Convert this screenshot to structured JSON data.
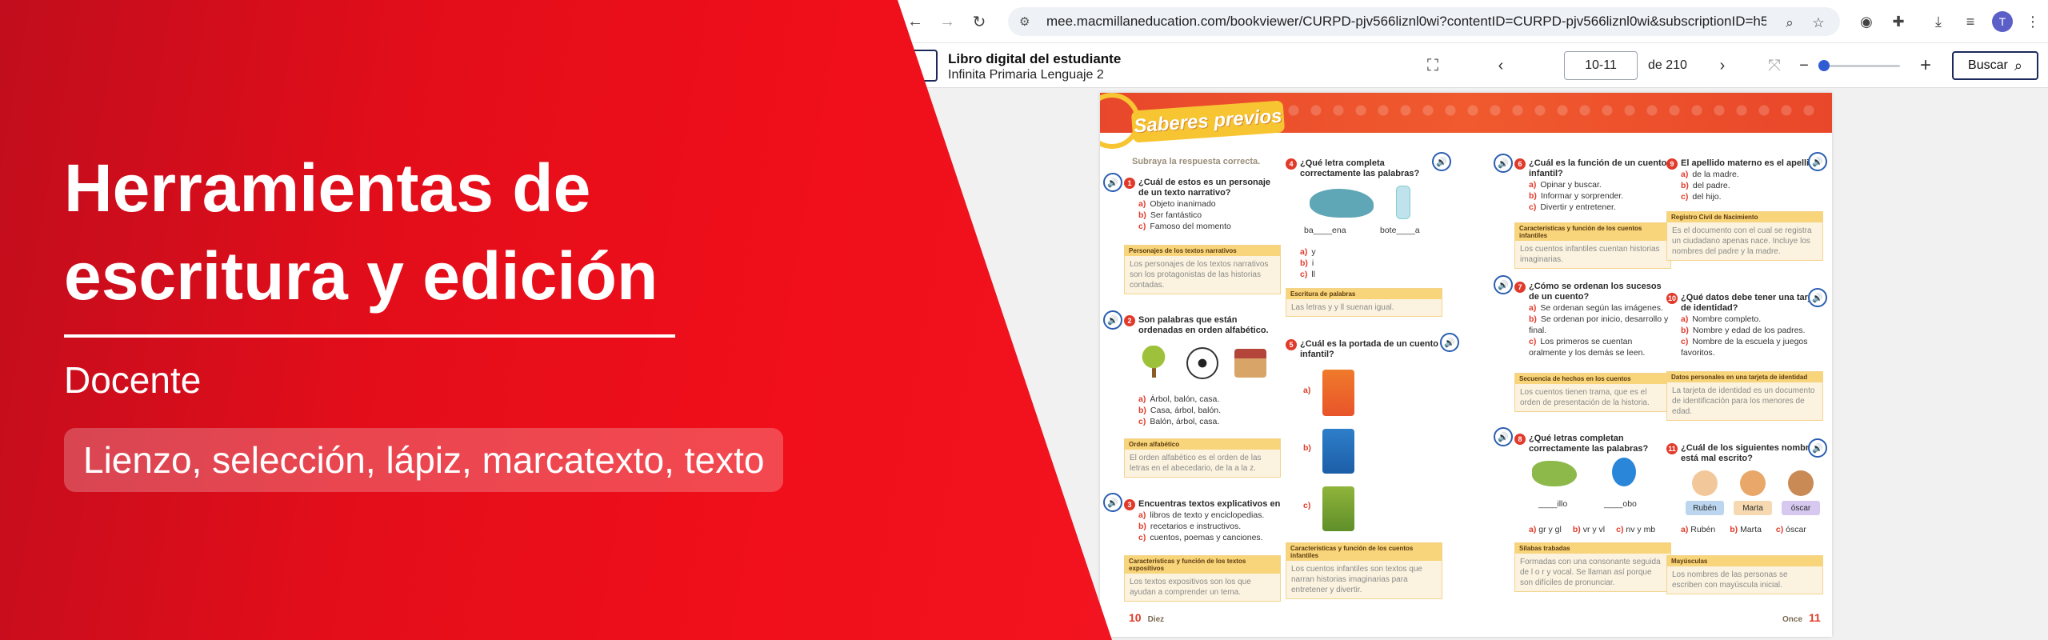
{
  "browser": {
    "url": "mee.macmillaneducation.com/bookviewer/CURPD-pjv566liznl0wi?contentID=CURPD-pjv566liznl0wi&subscriptionID=h5dnnn7s...",
    "avatar_initial": "T"
  },
  "viewer": {
    "book_title": "Libro digital del estudiante",
    "book_subtitle": "Infinita Primaria Lenguaje 2",
    "page_value": "10-11",
    "page_of": "de 210",
    "search_label": "Buscar"
  },
  "book": {
    "badge": "Saberes previos",
    "instruction": "Subraya la respuesta correcta.",
    "questions": [
      {
        "num": "1",
        "text": "¿Cuál de estos es un personaje de un texto narrativo?",
        "options": [
          "Objeto inanimado",
          "Ser fantástico",
          "Famoso del momento"
        ],
        "answer_head": "Personajes de los textos narrativos",
        "answer_body": "Los personajes de los textos narrativos son los protagonistas de las historias contadas."
      },
      {
        "num": "2",
        "text": "Son palabras que están ordenadas en orden alfabético.",
        "options": [
          "Árbol, balón, casa.",
          "Casa, árbol, balón.",
          "Balón, árbol, casa."
        ],
        "answer_head": "Orden alfabético",
        "answer_body": "El orden alfabético es el orden de las letras en el abecedario, de la a la z."
      },
      {
        "num": "3",
        "text": "Encuentras textos explicativos en",
        "options": [
          "libros de texto y enciclopedias.",
          "recetarios e instructivos.",
          "cuentos, poemas y canciones."
        ],
        "answer_head": "Características y función de los textos expositivos",
        "answer_body": "Los textos expositivos son los que ayudan a comprender un tema."
      },
      {
        "num": "4",
        "text": "¿Qué letra completa correctamente las palabras?",
        "words": [
          "ba____ena",
          "bote____a"
        ],
        "options": [
          "y",
          "i",
          "ll"
        ],
        "answer_head": "Escritura de palabras",
        "answer_body": "Las letras y y ll suenan igual."
      },
      {
        "num": "5",
        "text": "¿Cuál es la portada de un cuento infantil?",
        "options": [
          "",
          "",
          ""
        ],
        "answer_head": "Características y función de los cuentos infantiles",
        "answer_body": "Los cuentos infantiles son textos que narran historias imaginarias para entretener y divertir."
      },
      {
        "num": "6",
        "text": "¿Cuál es la función de un cuento infantil?",
        "options": [
          "Opinar y buscar.",
          "Informar y sorprender.",
          "Divertir y entretener."
        ],
        "answer_head": "Características y función de los cuentos infantiles",
        "answer_body": "Los cuentos infantiles cuentan historias imaginarias."
      },
      {
        "num": "7",
        "text": "¿Cómo se ordenan los sucesos de un cuento?",
        "options": [
          "Se ordenan según las imágenes.",
          "Se ordenan por inicio, desarrollo y final.",
          "Los primeros se cuentan oralmente y los demás se leen."
        ],
        "answer_head": "Secuencia de hechos en los cuentos",
        "answer_body": "Los cuentos tienen trama, que es el orden de presentación de la historia."
      },
      {
        "num": "8",
        "text": "¿Qué letras completan correctamente las palabras?",
        "words": [
          "____illo",
          "____obo"
        ],
        "options": [
          "gr y gl",
          "vr y vl",
          "nv y mb"
        ],
        "answer_head": "Sílabas trabadas",
        "answer_body": "Formadas con una consonante seguida de l o r y vocal. Se llaman así porque son difíciles de pronunciar."
      },
      {
        "num": "9",
        "text": "El apellido materno es el apellido",
        "options": [
          "de la madre.",
          "del padre.",
          "del hijo."
        ],
        "answer_head": "Registro Civil de Nacimiento",
        "answer_body": "Es el documento con el cual se registra un ciudadano apenas nace. Incluye los nombres del padre y la madre."
      },
      {
        "num": "10",
        "text": "¿Qué datos debe tener una tarjeta de identidad?",
        "options": [
          "Nombre completo.",
          "Nombre y edad de los padres.",
          "Nombre de la escuela y juegos favoritos."
        ],
        "answer_head": "Datos personales en una tarjeta de identidad",
        "answer_body": "La tarjeta de identidad es un documento de identificación para los menores de edad."
      },
      {
        "num": "11",
        "text": "¿Cuál de los siguientes nombres está mal escrito?",
        "names": [
          "Rubén",
          "Marta",
          "óscar"
        ],
        "options": [
          "Rubén",
          "Marta",
          "óscar"
        ],
        "answer_head": "Mayúsculas",
        "answer_body": "Los nombres de las personas se escriben con mayúscula inicial."
      }
    ],
    "letters": [
      "a)",
      "b)",
      "c)"
    ],
    "footer_left_num": "10",
    "footer_left_word": "Diez",
    "footer_right_word": "Once",
    "footer_right_num": "11"
  },
  "promo": {
    "title_line1": "Herramientas de",
    "title_line2": "escritura y edición",
    "role": "Docente",
    "tools": "Lienzo, selección, lápiz, marcatexto, texto"
  },
  "colors": {
    "promo_red": "#e30d1a",
    "book_header": "#f05a2e",
    "badge_yellow": "#f7c531",
    "accent_blue": "#2a5db0"
  }
}
